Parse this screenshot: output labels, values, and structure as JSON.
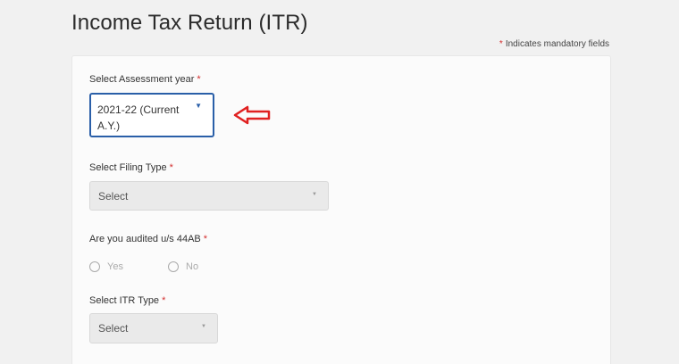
{
  "page": {
    "title": "Income Tax Return (ITR)",
    "mandatory_star": "*",
    "mandatory_note": "Indicates mandatory fields"
  },
  "form": {
    "required_marker": "*",
    "assessment_year": {
      "label": "Select Assessment year",
      "value": "2021-22  (Current A.Y.)"
    },
    "filing_type": {
      "label": "Select Filing Type",
      "value": "Select"
    },
    "audited": {
      "label": "Are you audited u/s 44AB",
      "options": [
        "Yes",
        "No"
      ]
    },
    "itr_type": {
      "label": "Select ITR Type",
      "value": "Select"
    }
  },
  "icons": {
    "dropdown": "chevron-down-icon",
    "pointer": "arrow-left-icon"
  },
  "colors": {
    "required": "#d32f2f",
    "focus_border": "#2a5fa8",
    "pointer_arrow": "#e02020"
  }
}
